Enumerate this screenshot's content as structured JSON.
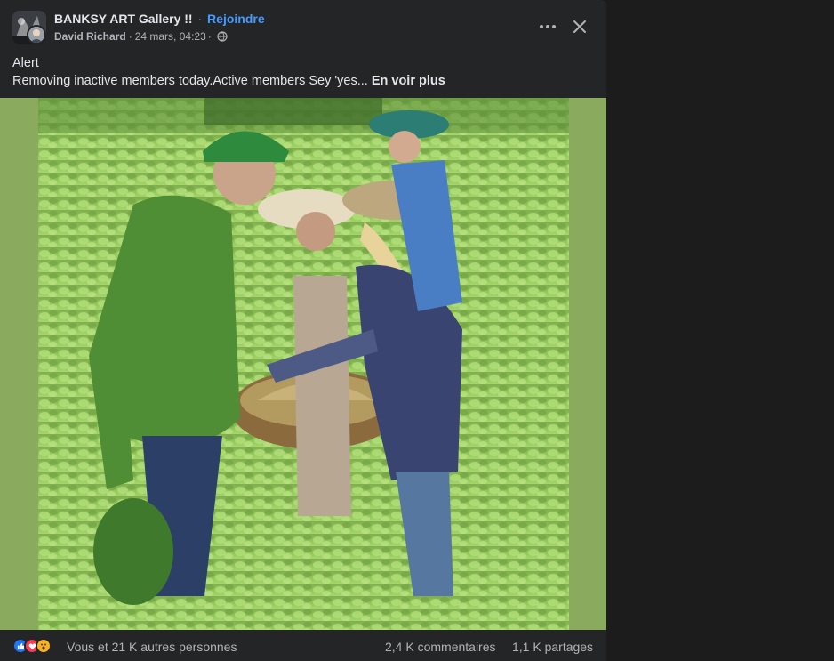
{
  "colors": {
    "background": "#1c1c1d",
    "card": "#242526",
    "primary_text": "#e4e6eb",
    "secondary_text": "#b0b3b8",
    "link": "#4599ff",
    "image_side_bars": "#8aab5d",
    "like": "#2078f4",
    "love": "#f33e58",
    "wow": "#f7b125"
  },
  "header": {
    "group_name": "BANKSY ART Gallery !!",
    "separator": "·",
    "join_label": "Rejoindre",
    "author": "David Richard",
    "meta_separator": "·",
    "timestamp": "24 mars, 04:23",
    "meta_trailing_separator": "·",
    "privacy_icon": "globe-icon",
    "more_icon": "more-options-icon",
    "close_icon": "close-icon"
  },
  "post": {
    "title": "Alert",
    "excerpt": "Removing inactive members today.Active members Sey 'yes...",
    "see_more_label": "En voir plus"
  },
  "image": {
    "description_icon": "photo-farmers-in-field"
  },
  "footer": {
    "reaction_icons": [
      "like-icon",
      "love-icon",
      "wow-icon"
    ],
    "reactions_text": "Vous et 21 K autres personnes",
    "comments_text": "2,4 K commentaires",
    "shares_text": "1,1 K partages"
  }
}
